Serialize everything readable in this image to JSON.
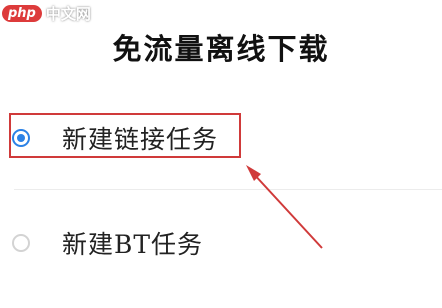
{
  "watermark": {
    "badge": "php",
    "site": "中文网"
  },
  "dialog": {
    "title": "免流量离线下载",
    "options": [
      {
        "label": "新建链接任务",
        "selected": true
      },
      {
        "label": "新建BT任务",
        "selected": false
      }
    ]
  },
  "annotation": {
    "highlight_color": "#d03a3a",
    "radio_accent": "#2c82e6"
  }
}
